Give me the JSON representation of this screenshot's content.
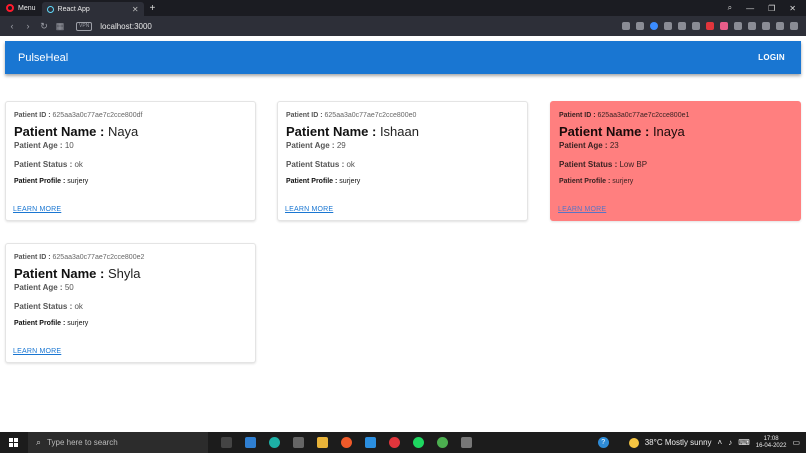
{
  "browser": {
    "menu_label": "Menu",
    "tab_title": "React App",
    "tab_close": "✕",
    "new_tab": "+",
    "url": "localhost:3000",
    "vpn_label": "VPN"
  },
  "appbar": {
    "brand": "PulseHeal",
    "login_label": "LOGIN"
  },
  "labels": {
    "id": "Patient ID :",
    "name": "Patient Name :",
    "age": "Patient Age :",
    "status": "Patient Status :",
    "profile": "Patient Profile :",
    "learn_more": "LEARN MORE"
  },
  "patients": [
    {
      "id": "625aa3a0c77ae7c2cce800df",
      "name": "Naya",
      "age": "10",
      "status": "ok",
      "profile": "surjery",
      "highlight": false
    },
    {
      "id": "625aa3a0c77ae7c2cce800e0",
      "name": "Ishaan",
      "age": "29",
      "status": "ok",
      "profile": "surjery",
      "highlight": false
    },
    {
      "id": "625aa3a0c77ae7c2cce800e1",
      "name": "Inaya",
      "age": "23",
      "status": "Low BP",
      "profile": "surjery",
      "highlight": true
    },
    {
      "id": "625aa3a0c77ae7c2cce800e2",
      "name": "Shyla",
      "age": "50",
      "status": "ok",
      "profile": "surjery",
      "highlight": false
    }
  ],
  "taskbar": {
    "search_placeholder": "Type here to search",
    "weather": "38°C  Mostly sunny",
    "time": "17:08",
    "date": "16-04-2022"
  },
  "colors": {
    "appbar": "#1976d2",
    "alert_card": "#ff7f7f"
  }
}
